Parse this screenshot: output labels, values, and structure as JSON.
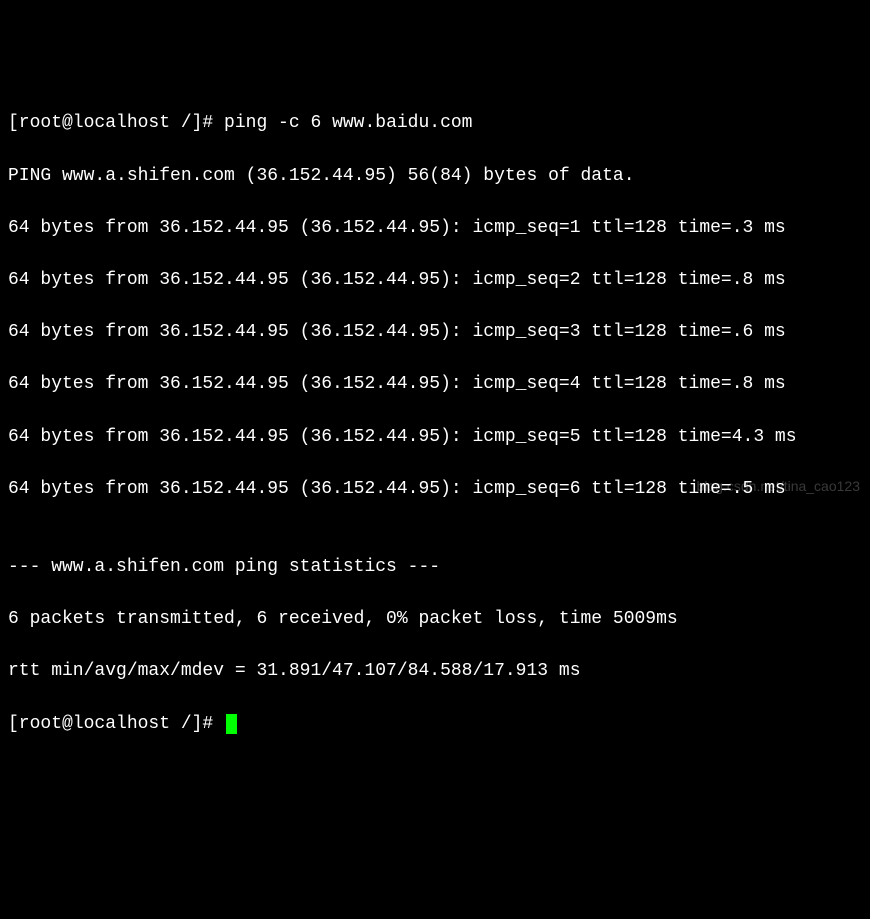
{
  "terminal": {
    "prompt1": "[root@localhost /]# ",
    "command": "ping -c 6 www.baidu.com",
    "ping_header": "PING www.a.shifen.com (36.152.44.95) 56(84) bytes of data.",
    "replies": [
      "64 bytes from 36.152.44.95 (36.152.44.95): icmp_seq=1 ttl=128 time=.3 ms",
      "64 bytes from 36.152.44.95 (36.152.44.95): icmp_seq=2 ttl=128 time=.8 ms",
      "64 bytes from 36.152.44.95 (36.152.44.95): icmp_seq=3 ttl=128 time=.6 ms",
      "64 bytes from 36.152.44.95 (36.152.44.95): icmp_seq=4 ttl=128 time=.8 ms",
      "64 bytes from 36.152.44.95 (36.152.44.95): icmp_seq=5 ttl=128 time=4.3 ms",
      "64 bytes from 36.152.44.95 (36.152.44.95): icmp_seq=6 ttl=128 time=.5 ms"
    ],
    "blank": "",
    "stats_header": "--- www.a.shifen.com ping statistics ---",
    "stats_summary": "6 packets transmitted, 6 received, 0% packet loss, time 5009ms",
    "stats_rtt": "rtt min/avg/max/mdev = 31.891/47.107/84.588/17.913 ms",
    "prompt2": "[root@localhost /]# "
  },
  "watermark": "blog.csdn.net/tina_cao123"
}
